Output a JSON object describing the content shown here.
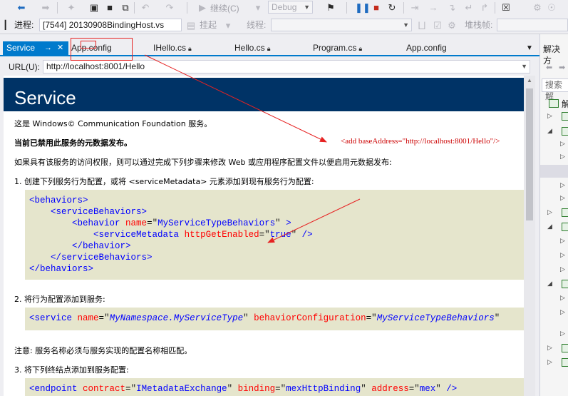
{
  "toolbar": {
    "continue_label": "继续(C)",
    "config_value": "Debug"
  },
  "debugbar": {
    "process_label": "进程:",
    "process_value": "[7544] 20130908BindingHost.vs",
    "suspend_label": "挂起",
    "thread_label": "线程:",
    "stackframe_label": "堆栈帧:"
  },
  "tabs": [
    {
      "label": "Service",
      "active": true
    },
    {
      "label": "App.config"
    },
    {
      "label": "IHello.cs"
    },
    {
      "label": "Hello.cs"
    },
    {
      "label": "Program.cs"
    },
    {
      "label": "App.config"
    }
  ],
  "solution": {
    "title": "解决方",
    "search_placeholder": "搜索解"
  },
  "url": {
    "label": "URL(U):",
    "value": "http://localhost:8001/Hello"
  },
  "page": {
    "title": "Service",
    "p1": "这是 Windows© Communication Foundation 服务。",
    "p2": "当前已禁用此服务的元数据发布。",
    "p3": "如果具有该服务的访问权限，则可以通过完成下列步骤来修改 Web 或应用程序配置文件以便启用元数据发布:",
    "step1": "1. 创建下列服务行为配置，或将 <serviceMetadata> 元素添加到现有服务行为配置:",
    "step2": "2. 将行为配置添加到服务:",
    "note": "注意: 服务名称必须与服务实现的配置名称相匹配。",
    "step3": "3. 将下列终结点添加到服务配置:"
  },
  "annotation": {
    "text": "<add baseAddress=\"http://localhost:8001/Hello\"/>"
  },
  "colors": {
    "accent": "#007acc",
    "hero": "#003366",
    "code_bg": "#e5e5cc",
    "annotation": "#e62222"
  }
}
